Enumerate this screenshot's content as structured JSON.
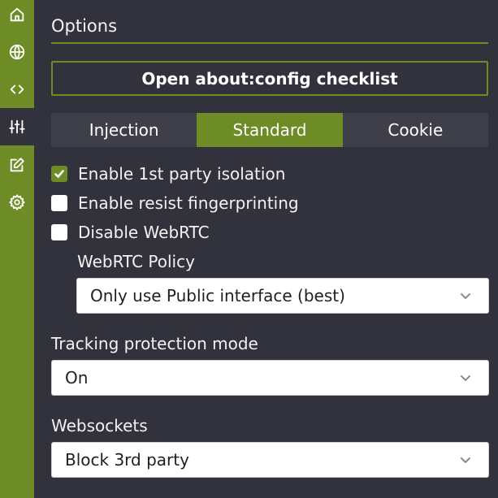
{
  "sidebar": {
    "items": [
      {
        "icon": "home-icon"
      },
      {
        "icon": "globe-icon"
      },
      {
        "icon": "code-icon"
      },
      {
        "icon": "sliders-icon",
        "active": true
      },
      {
        "icon": "edit-icon"
      },
      {
        "icon": "gear-icon"
      }
    ]
  },
  "header": {
    "title": "Options"
  },
  "config_button": {
    "label": "Open about:config checklist"
  },
  "tabs": [
    {
      "label": "Injection"
    },
    {
      "label": "Standard",
      "active": true
    },
    {
      "label": "Cookie"
    }
  ],
  "options": {
    "first_party_isolation": {
      "label": "Enable 1st party isolation",
      "checked": true
    },
    "resist_fingerprinting": {
      "label": "Enable resist fingerprinting",
      "checked": false
    },
    "disable_webrtc": {
      "label": "Disable WebRTC",
      "checked": false
    }
  },
  "webrtc_policy": {
    "label": "WebRTC Policy",
    "value": "Only use Public interface (best)"
  },
  "tracking_protection": {
    "label": "Tracking protection mode",
    "value": "On"
  },
  "websockets": {
    "label": "Websockets",
    "value": "Block 3rd party"
  },
  "colors": {
    "accent": "#6d8c25",
    "background": "#32323c",
    "tab_inactive": "#3f3f4a"
  }
}
